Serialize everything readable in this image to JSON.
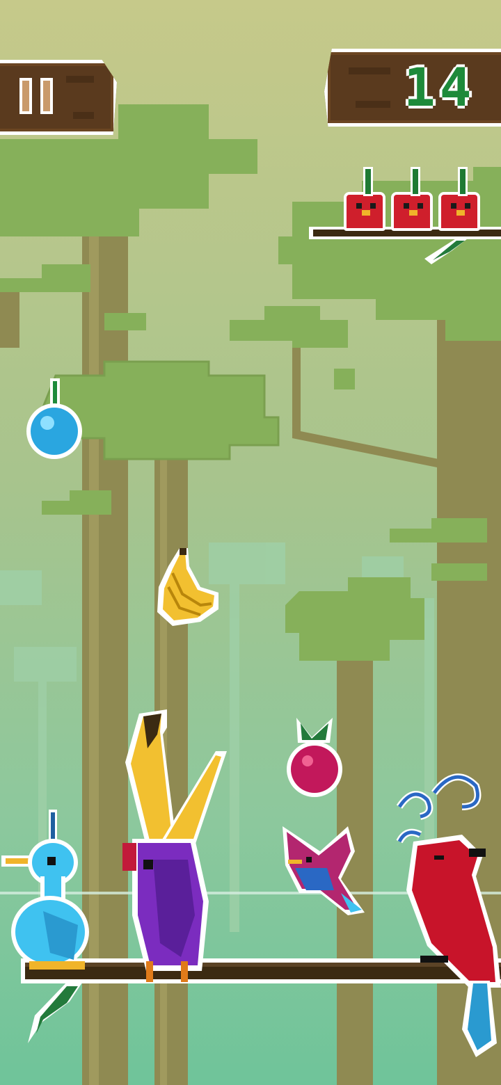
{
  "hud": {
    "score": "14",
    "lives": 3,
    "pause_icon": "pause-icon"
  },
  "items": {
    "fruits": [
      "blue-berry",
      "banana",
      "pink-berry"
    ],
    "birds": [
      "blue-bird",
      "purple-toucan",
      "pink-bird",
      "red-cardinal"
    ]
  },
  "colors": {
    "sky_top": "#c6c98a",
    "sky_bottom": "#6fc49a",
    "foliage": "#86b05a",
    "trunk": "#8f8a52",
    "branch": "#3b2a12",
    "plank": "#5a3a1e",
    "score_green": "#1e8a3a",
    "life_red": "#cf1f2c"
  }
}
